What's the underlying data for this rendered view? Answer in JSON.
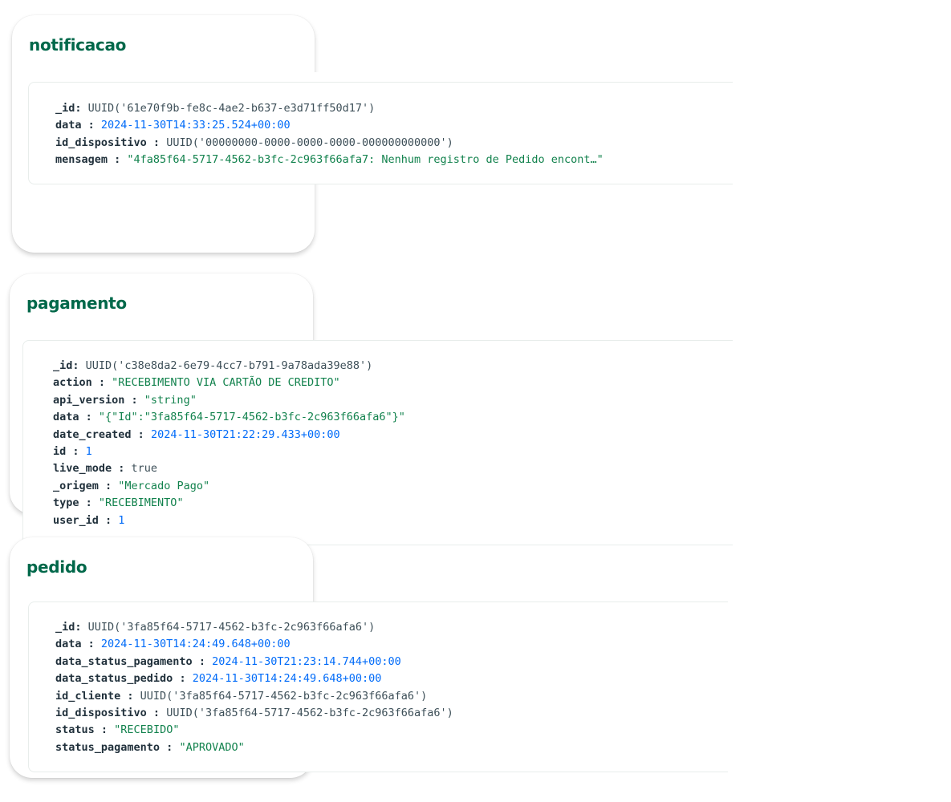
{
  "collections": [
    {
      "name": "notificacao",
      "document": [
        {
          "key": "_id",
          "value": "UUID('61e70f9b-fe8c-4ae2-b637-e3d71ff50d17')",
          "kind": "plain"
        },
        {
          "key": "data",
          "value": "2024-11-30T14:33:25.524+00:00",
          "kind": "date"
        },
        {
          "key": "id_dispositivo",
          "value": "UUID('00000000-0000-0000-0000-000000000000')",
          "kind": "plain"
        },
        {
          "key": "mensagem",
          "value": "\"4fa85f64-5717-4562-b3fc-2c963f66afa7: Nenhum registro de Pedido encont…\"",
          "kind": "str"
        }
      ]
    },
    {
      "name": "pagamento",
      "document": [
        {
          "key": "_id",
          "value": "UUID('c38e8da2-6e79-4cc7-b791-9a78ada39e88')",
          "kind": "plain"
        },
        {
          "key": "action",
          "value": "\"RECEBIMENTO VIA CARTÃO DE CREDITO\"",
          "kind": "str"
        },
        {
          "key": "api_version",
          "value": "\"string\"",
          "kind": "str"
        },
        {
          "key": "data",
          "value": "\"{\"Id\":\"3fa85f64-5717-4562-b3fc-2c963f66afa6\"}\"",
          "kind": "str"
        },
        {
          "key": "date_created",
          "value": "2024-11-30T21:22:29.433+00:00",
          "kind": "date"
        },
        {
          "key": "id",
          "value": "1",
          "kind": "num"
        },
        {
          "key": "live_mode",
          "value": "true",
          "kind": "plain"
        },
        {
          "key": "_origem",
          "value": "\"Mercado Pago\"",
          "kind": "str"
        },
        {
          "key": "type",
          "value": "\"RECEBIMENTO\"",
          "kind": "str"
        },
        {
          "key": "user_id",
          "value": "1",
          "kind": "num"
        }
      ]
    },
    {
      "name": "pedido",
      "document": [
        {
          "key": "_id",
          "value": "UUID('3fa85f64-5717-4562-b3fc-2c963f66afa6')",
          "kind": "plain"
        },
        {
          "key": "data",
          "value": "2024-11-30T14:24:49.648+00:00",
          "kind": "date"
        },
        {
          "key": "data_status_pagamento",
          "value": "2024-11-30T21:23:14.744+00:00",
          "kind": "date"
        },
        {
          "key": "data_status_pedido",
          "value": "2024-11-30T14:24:49.648+00:00",
          "kind": "date"
        },
        {
          "key": "id_cliente",
          "value": "UUID('3fa85f64-5717-4562-b3fc-2c963f66afa6')",
          "kind": "plain"
        },
        {
          "key": "id_dispositivo",
          "value": "UUID('3fa85f64-5717-4562-b3fc-2c963f66afa6')",
          "kind": "plain"
        },
        {
          "key": "status",
          "value": "\"RECEBIDO\"",
          "kind": "str"
        },
        {
          "key": "status_pagamento",
          "value": "\"APROVADO\"",
          "kind": "str"
        }
      ]
    }
  ]
}
